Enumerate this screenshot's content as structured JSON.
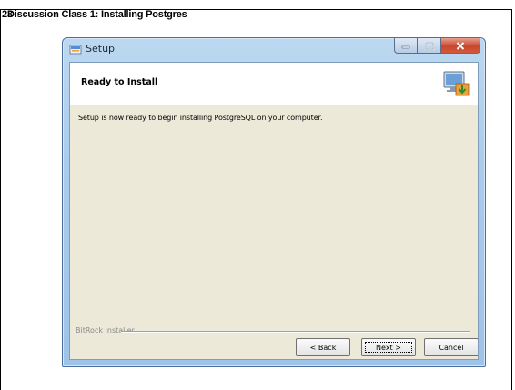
{
  "slide": {
    "number": "23",
    "title": "Discussion  Class 1: Installing Postgres"
  },
  "window": {
    "title": "Setup",
    "controls": [
      "minimize",
      "maximize",
      "close"
    ]
  },
  "installer": {
    "header_title": "Ready to Install",
    "description": "Setup is now ready to begin installing PostgreSQL on your computer.",
    "brand": "BitRock Installer",
    "buttons": {
      "back": "< Back",
      "next": "Next >",
      "cancel": "Cancel"
    },
    "icons": {
      "app": "setup-app-icon",
      "header": "computer-install-icon"
    }
  },
  "colors": {
    "titlebar": "#a9cbec",
    "close_button": "#c9462c",
    "dialog_body": "#ece9d8"
  }
}
